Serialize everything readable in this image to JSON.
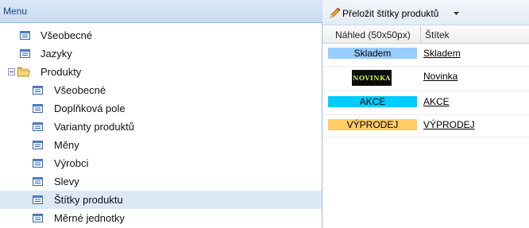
{
  "menu": {
    "title": "Menu",
    "items": [
      {
        "label": "Všeobecné",
        "icon": "list-icon"
      },
      {
        "label": "Jazyky",
        "icon": "list-icon"
      },
      {
        "label": "Produkty",
        "icon": "folder-icon",
        "expanded": true,
        "children": [
          {
            "label": "Všeobecné",
            "icon": "list-icon"
          },
          {
            "label": "Doplňková pole",
            "icon": "list-icon"
          },
          {
            "label": "Varianty produktů",
            "icon": "list-icon"
          },
          {
            "label": "Měny",
            "icon": "list-icon"
          },
          {
            "label": "Výrobci",
            "icon": "list-icon"
          },
          {
            "label": "Slevy",
            "icon": "list-icon"
          },
          {
            "label": "Štítky produktu",
            "icon": "list-icon",
            "selected": true
          },
          {
            "label": "Měrné jednotky",
            "icon": "list-icon"
          }
        ]
      }
    ]
  },
  "toolbar": {
    "translate_label": "Přeložit štítky produktů",
    "icon": "pencil-icon"
  },
  "grid": {
    "columns": [
      "Náhled (50x50px)",
      "Štítek"
    ],
    "rows": [
      {
        "preview_text": "Skladem",
        "label": "Skladem",
        "color": "#99ccff"
      },
      {
        "preview_text": "NOVINKA",
        "label": "Novinka",
        "color": "#0c0c0c",
        "text_color": "#c7ef4a"
      },
      {
        "preview_text": "AKCE",
        "label": "AKCE",
        "color": "#00ccff"
      },
      {
        "preview_text": "VÝPRODEJ",
        "label": "VÝPRODEJ",
        "color": "#ffcc66"
      }
    ]
  }
}
